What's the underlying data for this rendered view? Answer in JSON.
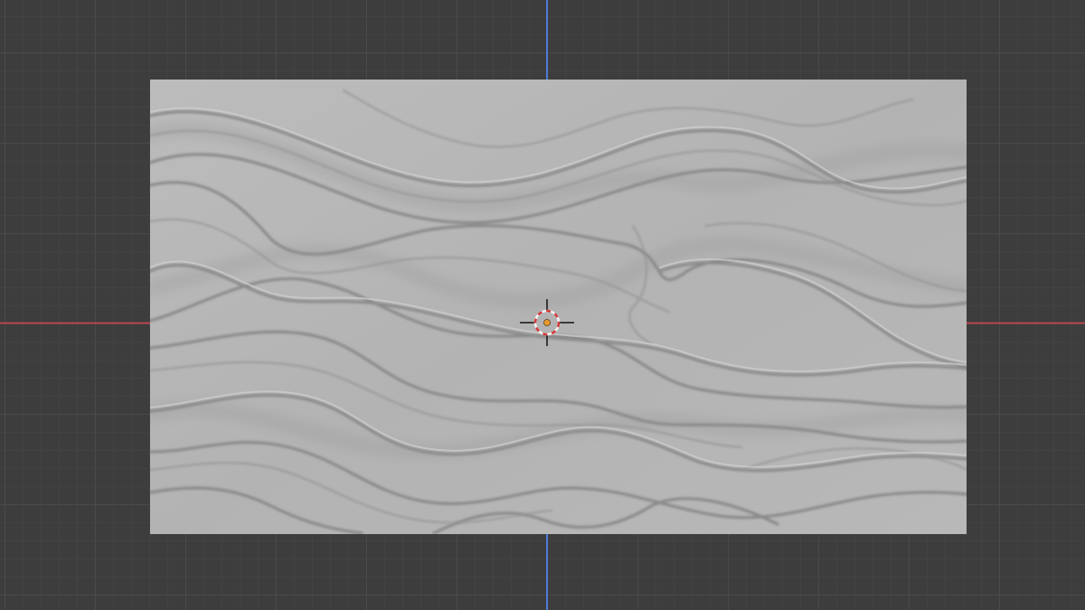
{
  "viewport": {
    "view": "top-orthographic",
    "background_color": "#3d3d3d",
    "grid_minor_color": "#474747",
    "grid_major_color": "#525252",
    "axis_x_color": "#b8454f",
    "axis_y_color": "#4d7ad6"
  },
  "object": {
    "type": "plane",
    "surface": "wavy-relief-panel",
    "color": "#b6b6b6",
    "selected": false
  },
  "cursor": {
    "icon": "3d-cursor-icon",
    "ring_colors": [
      "#d23a3a",
      "#f2f2f2"
    ]
  },
  "origin": {
    "icon": "object-origin-dot",
    "color": "#e89a2c"
  }
}
